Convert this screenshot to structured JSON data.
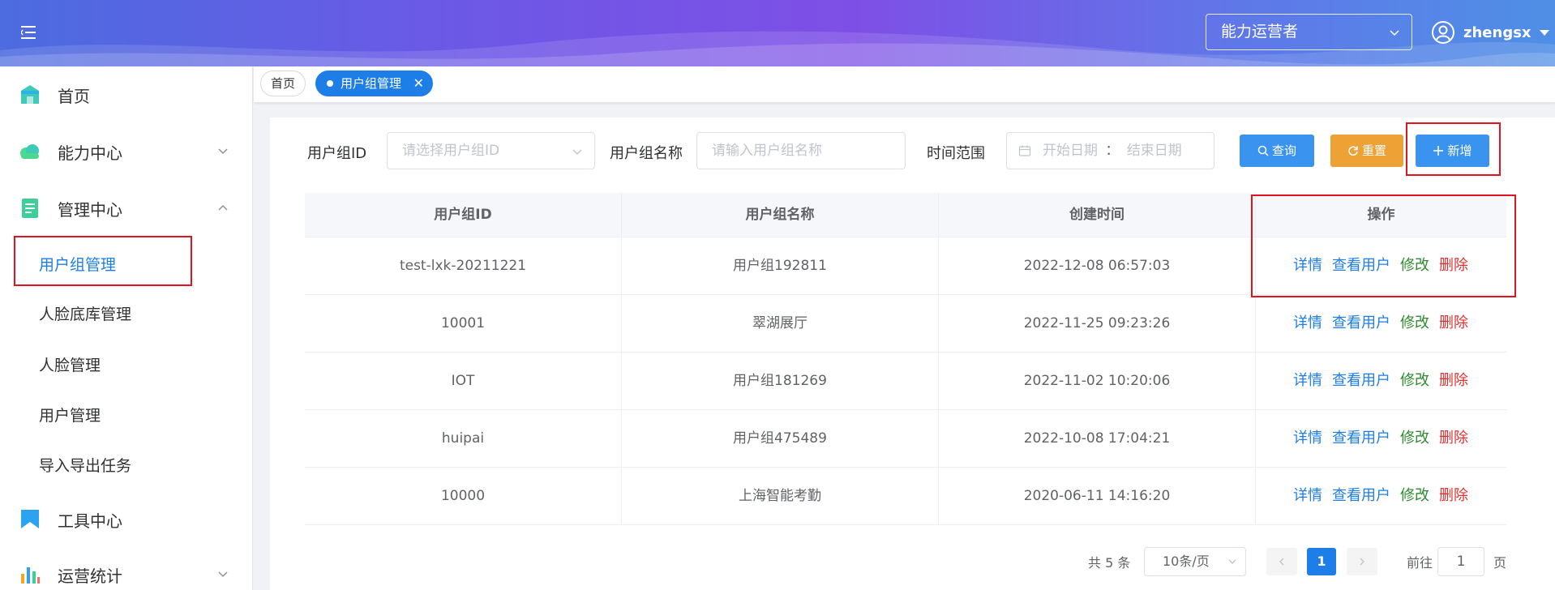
{
  "header": {
    "role_select": "能力运营者",
    "user_name": "zhengsx"
  },
  "sidebar": {
    "items": [
      {
        "label": "首页",
        "icon": "home-icon"
      },
      {
        "label": "能力中心",
        "icon": "cloud-icon"
      },
      {
        "label": "管理中心",
        "icon": "document-icon"
      },
      {
        "label": "工具中心",
        "icon": "flag-icon"
      },
      {
        "label": "运营统计",
        "icon": "bar-chart-icon"
      }
    ],
    "sub_items": [
      "用户组管理",
      "人脸底库管理",
      "人脸管理",
      "用户管理",
      "导入导出任务"
    ]
  },
  "tabs": {
    "home": "首页",
    "active": "用户组管理"
  },
  "filters": {
    "group_id_label": "用户组ID",
    "group_id_placeholder": "请选择用户组ID",
    "group_name_label": "用户组名称",
    "group_name_placeholder": "请输入用户组名称",
    "time_label": "时间范围",
    "start_placeholder": "开始日期",
    "separator": "：",
    "end_placeholder": "结束日期"
  },
  "buttons": {
    "query": "查询",
    "reset": "重置",
    "add": "新增"
  },
  "table": {
    "headers": [
      "用户组ID",
      "用户组名称",
      "创建时间",
      "操作"
    ],
    "rows": [
      {
        "id": "test-lxk-20211221",
        "name": "用户组192811",
        "created": "2022-12-08 06:57:03"
      },
      {
        "id": "10001",
        "name": "翠湖展厅",
        "created": "2022-11-25 09:23:26"
      },
      {
        "id": "IOT",
        "name": "用户组181269",
        "created": "2022-11-02 10:20:06"
      },
      {
        "id": "huipai",
        "name": "用户组475489",
        "created": "2022-10-08 17:04:21"
      },
      {
        "id": "10000",
        "name": "上海智能考勤",
        "created": "2020-06-11 14:16:20"
      }
    ],
    "actions": {
      "detail": "详情",
      "view_users": "查看用户",
      "edit": "修改",
      "delete": "删除"
    }
  },
  "pagination": {
    "total": "共 5 条",
    "page_size": "10条/页",
    "current_page": "1",
    "goto_prefix": "前往",
    "goto_value": "1",
    "goto_suffix": "页"
  },
  "colors": {
    "accent": "#1e7ee8",
    "reset_button": "#eea236",
    "edit_action": "#2e8b2e",
    "delete_action": "#e03030",
    "highlight_box": "#e0141e"
  }
}
